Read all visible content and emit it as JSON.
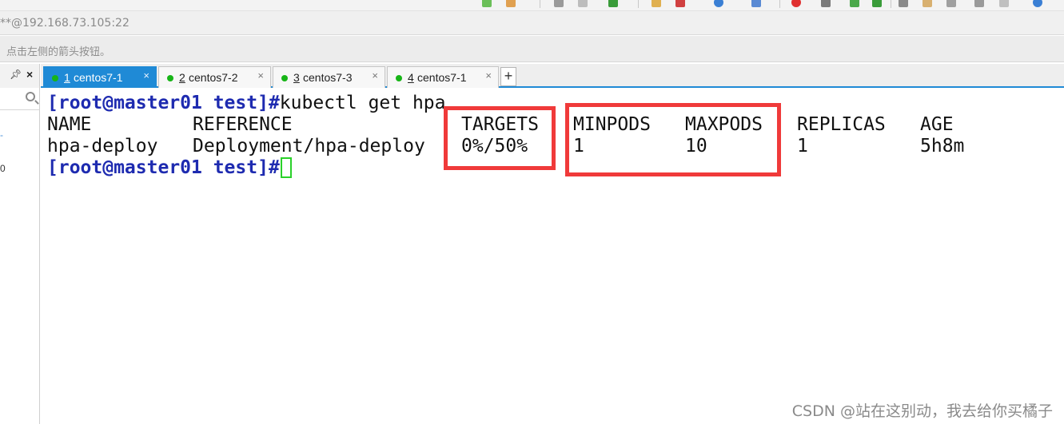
{
  "window": {
    "address": "**@192.168.73.105:22",
    "hint": "点击左侧的箭头按钮。"
  },
  "side_panel": {
    "frag1": "-",
    "frag2": "0"
  },
  "tabs": [
    {
      "num": "1",
      "label": "centos7-1",
      "active": true
    },
    {
      "num": "2",
      "label": "centos7-2",
      "active": false
    },
    {
      "num": "3",
      "label": "centos7-3",
      "active": false
    },
    {
      "num": "4",
      "label": "centos7-1",
      "active": false
    }
  ],
  "terminal": {
    "prompt": "[root@master01 test]#",
    "command": "kubectl get hpa",
    "headers": [
      "NAME",
      "REFERENCE",
      "TARGETS",
      "MINPODS",
      "MAXPODS",
      "REPLICAS",
      "AGE"
    ],
    "rows": [
      [
        "hpa-deploy",
        "Deployment/hpa-deploy",
        "0%/50%",
        "1",
        "10",
        "1",
        "5h8m"
      ]
    ]
  },
  "colors": {
    "prompt": "#1e2bb0",
    "highlight": "#f03a3a",
    "tab_active": "#1f8ad6",
    "status_dot": "#17b517"
  },
  "watermark": "CSDN @站在这别动，我去给你买橘子"
}
